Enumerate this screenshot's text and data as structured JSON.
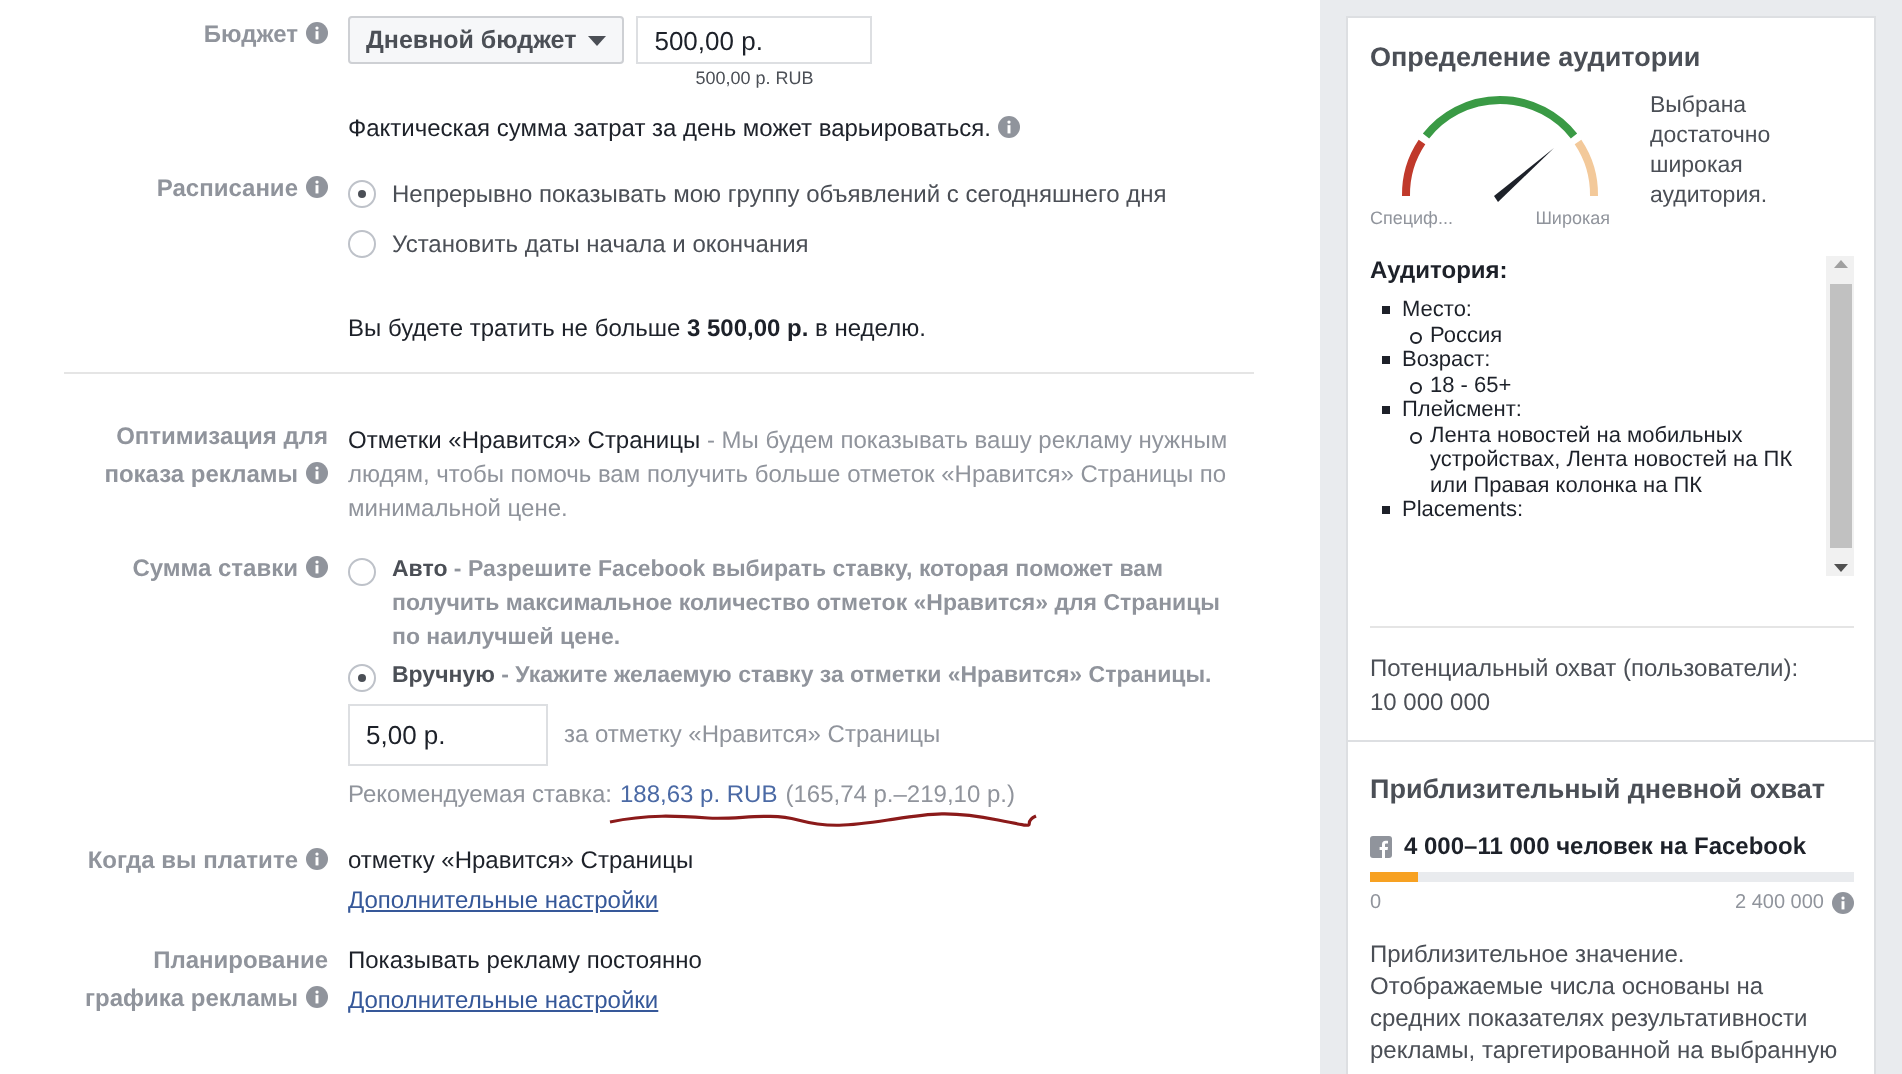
{
  "budget": {
    "label": "Бюджет",
    "dropdown": "Дневной бюджет",
    "amount": "500,00 р.",
    "amount_note": "500,00 р. RUB",
    "note": "Фактическая сумма затрат за день может варьироваться."
  },
  "schedule": {
    "label": "Расписание",
    "options": [
      {
        "label": "Непрерывно показывать мою группу объявлений с сегодняшнего дня",
        "selected": true
      },
      {
        "label": "Установить даты начала и окончания",
        "selected": false
      }
    ],
    "summary": "Вы будете тратить не больше **3 500,00 р.** в неделю."
  },
  "optimization": {
    "label": "Оптимизация для показа рекламы",
    "value": "Отметки «Нравится» Страницы",
    "description": " - Мы будем показывать вашу рекламу нужным людям, чтобы помочь вам получить больше отметок «Нравится» Страницы по минимальной цене."
  },
  "bid": {
    "label": "Сумма ставки",
    "options": [
      {
        "title": "Авто",
        "description": " - Разрешите Facebook выбирать ставку, которая поможет вам получить максимальное количество отметок «Нравится» для Страницы по наилучшей цене.",
        "selected": false
      },
      {
        "title": "Вручную",
        "description": " - Укажите желаемую ставку за отметки «Нравится» Страницы.",
        "selected": true
      }
    ],
    "amount": "5,00 р.",
    "amount_suffix": "за отметку «Нравится» Страницы",
    "recommended_label": "Рекомендуемая ставка:",
    "recommended_value": "188,63 р. RUB",
    "recommended_range": "(165,74 р.–219,10 р.)"
  },
  "billing": {
    "label": "Когда вы платите",
    "value": "отметку «Нравится» Страницы",
    "link": "Дополнительные настройки"
  },
  "planning": {
    "label": "Планирование графика рекламы",
    "value": "Показывать рекламу постоянно",
    "link": "Дополнительные настройки"
  },
  "audience": {
    "title": "Определение аудитории",
    "gauge_min": "Специф...",
    "gauge_max": "Широкая",
    "verdict": "Выбрана достаточно широкая аудитория.",
    "list_title": "Аудитория:",
    "items": [
      {
        "label": "Место:",
        "children": [
          {
            "label": "Россия"
          }
        ]
      },
      {
        "label": "Возраст:",
        "children": [
          {
            "label": "18 - 65+"
          }
        ]
      },
      {
        "label": "Плейсмент:",
        "children": [
          {
            "label": "Лента новостей на мобильных устройствах, Лента новостей на ПК или Правая колонка на ПК"
          }
        ]
      },
      {
        "label": "Placements:"
      }
    ],
    "potential_label": "Потенциальный охват (пользователи):",
    "potential_value": "10 000 000"
  },
  "daily_reach": {
    "title": "Приблизительный дневной охват",
    "value": "4 000–11 000 человек на Facebook",
    "level": 0.1,
    "min": "0",
    "max": "2 400 000",
    "description": "Приблизительное значение. Отображаемые числа основаны на средних показателях результативности рекламы, таргетированной на выбранную"
  }
}
